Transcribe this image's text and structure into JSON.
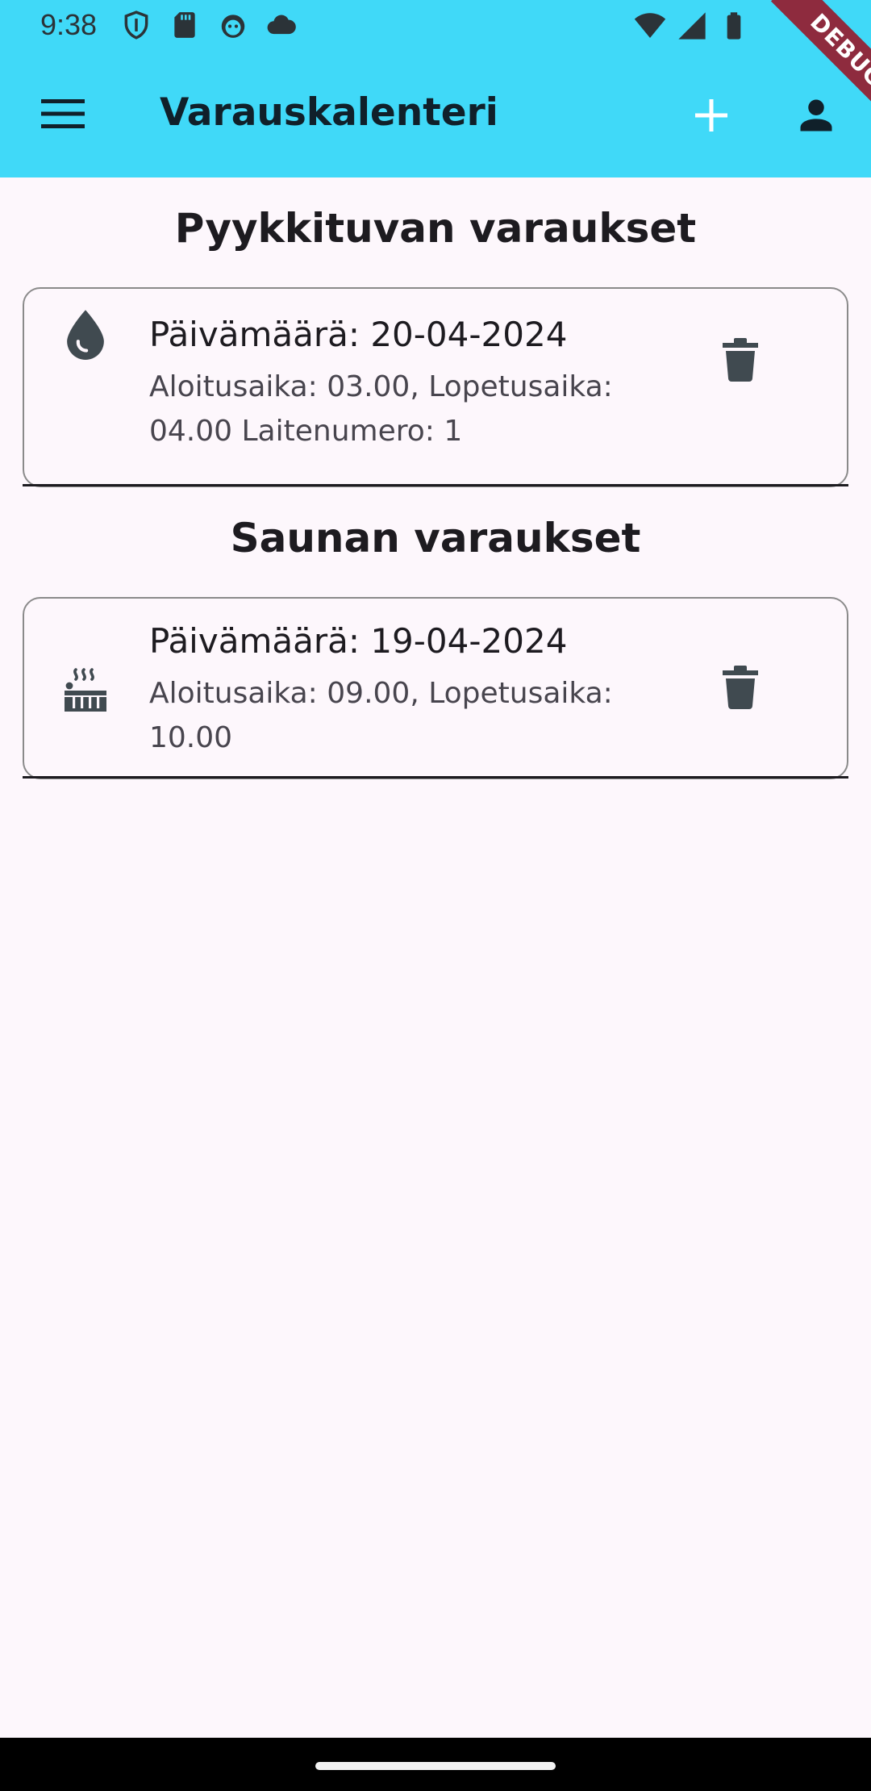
{
  "status_bar": {
    "time": "9:38",
    "left_icons": [
      "shield-icon",
      "sd-card-icon",
      "android-face-icon",
      "cloud-icon"
    ],
    "right_icons": [
      "wifi-icon",
      "signal-icon",
      "battery-icon"
    ]
  },
  "app_bar": {
    "title": "Varauskalenteri",
    "menu_icon": "menu-icon",
    "add_icon": "add-icon",
    "account_icon": "person-icon",
    "background": "#40d9f8"
  },
  "debug_banner": "DEBUG",
  "sections": [
    {
      "title": "Pyykkituvan varaukset",
      "reservations": [
        {
          "icon": "water-drop-icon",
          "date": "Päivämäärä: 20-04-2024",
          "details_line1": "Aloitusaika: 03.00, Lopetusaika:",
          "details_line2": "04.00 Laitenumero: 1"
        }
      ]
    },
    {
      "title": "Saunan varaukset",
      "reservations": [
        {
          "icon": "hot-tub-icon",
          "date": "Päivämäärä: 19-04-2024",
          "details_line1": "Aloitusaika: 09.00, Lopetusaika:",
          "details_line2": "10.00"
        }
      ]
    }
  ]
}
